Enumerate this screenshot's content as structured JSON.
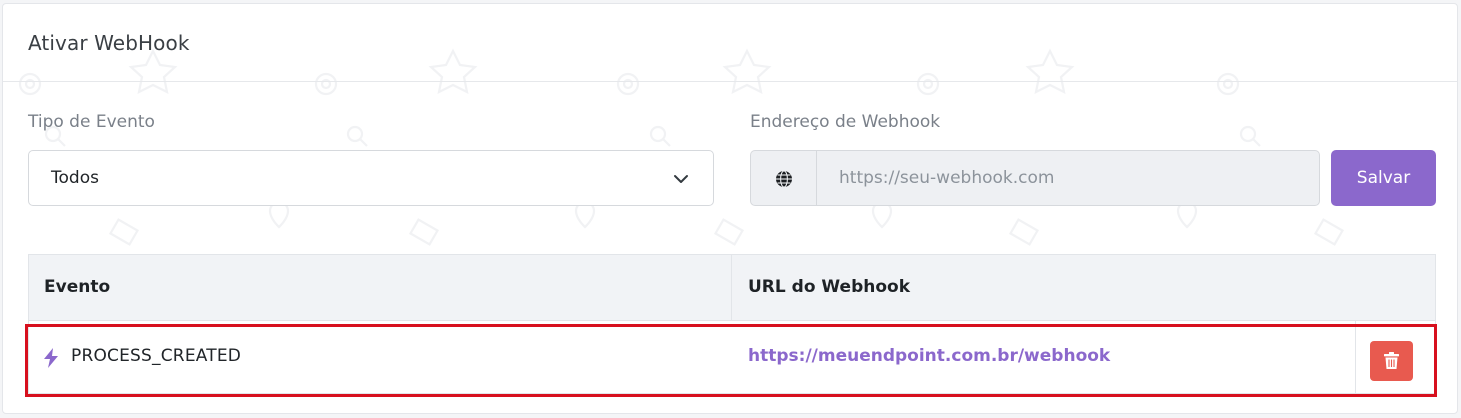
{
  "card": {
    "title": "Ativar WebHook"
  },
  "event_type": {
    "label": "Tipo de Evento",
    "selected": "Todos",
    "caret_icon": "chevron-down-icon"
  },
  "webhook_address": {
    "label": "Endereço de Webhook",
    "prepend_icon": "globe-icon",
    "placeholder": "https://seu-webhook.com",
    "value": ""
  },
  "save_button": {
    "label": "Salvar"
  },
  "table": {
    "columns": [
      "Evento",
      "URL do Webhook"
    ],
    "rows": [
      {
        "event_icon": "bolt-icon",
        "event": "PROCESS_CREATED",
        "url": "https://meuendpoint.com.br/webhook",
        "action_icon": "trash-icon"
      }
    ]
  },
  "colors": {
    "accent": "#8b68cc",
    "danger": "#e85a4f",
    "highlight": "#d7101e"
  }
}
